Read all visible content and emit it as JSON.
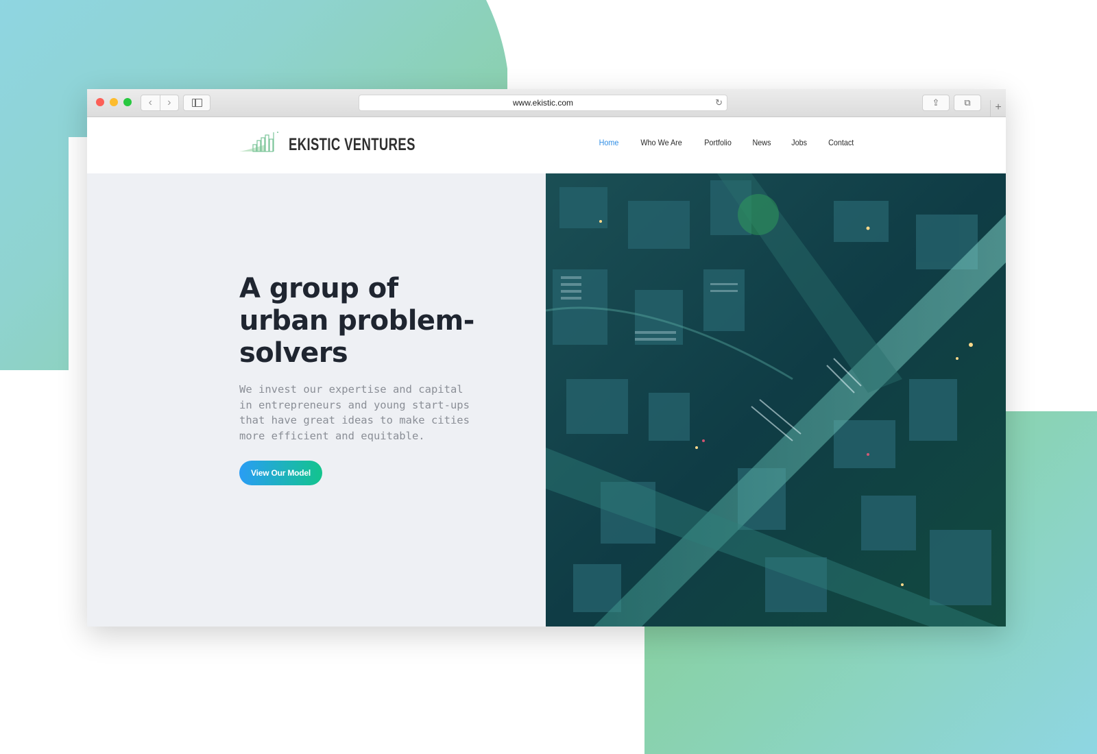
{
  "browser": {
    "url": "www.ekistic.com",
    "back_glyph": "‹",
    "forward_glyph": "›",
    "reload_glyph": "↻",
    "share_glyph": "⇪",
    "tabs_glyph": "⧉",
    "newtab_glyph": "+"
  },
  "site": {
    "brand": "EKISTIC VENTURES",
    "nav": [
      {
        "label": "Home",
        "active": true
      },
      {
        "label": "Who We Are",
        "active": false
      },
      {
        "label": "Portfolio",
        "active": false
      },
      {
        "label": "News",
        "active": false
      },
      {
        "label": "Jobs",
        "active": false
      },
      {
        "label": "Contact",
        "active": false
      }
    ]
  },
  "hero": {
    "headline": "A group of urban problem-solvers",
    "lead": "We invest our expertise and capital in entrepreneurs and young start-ups that have great ideas to make cities more efficient and equitable.",
    "cta_label": "View Our Model",
    "image_subject": "aerial night view of city intersection"
  },
  "colors": {
    "accent": "#2f8ee5",
    "cta_start": "#2a9df4",
    "cta_end": "#13c48d",
    "hero_bg": "#eef0f4",
    "blob_green": "#86cd8e",
    "blob_cyan": "#8fd6e6"
  }
}
